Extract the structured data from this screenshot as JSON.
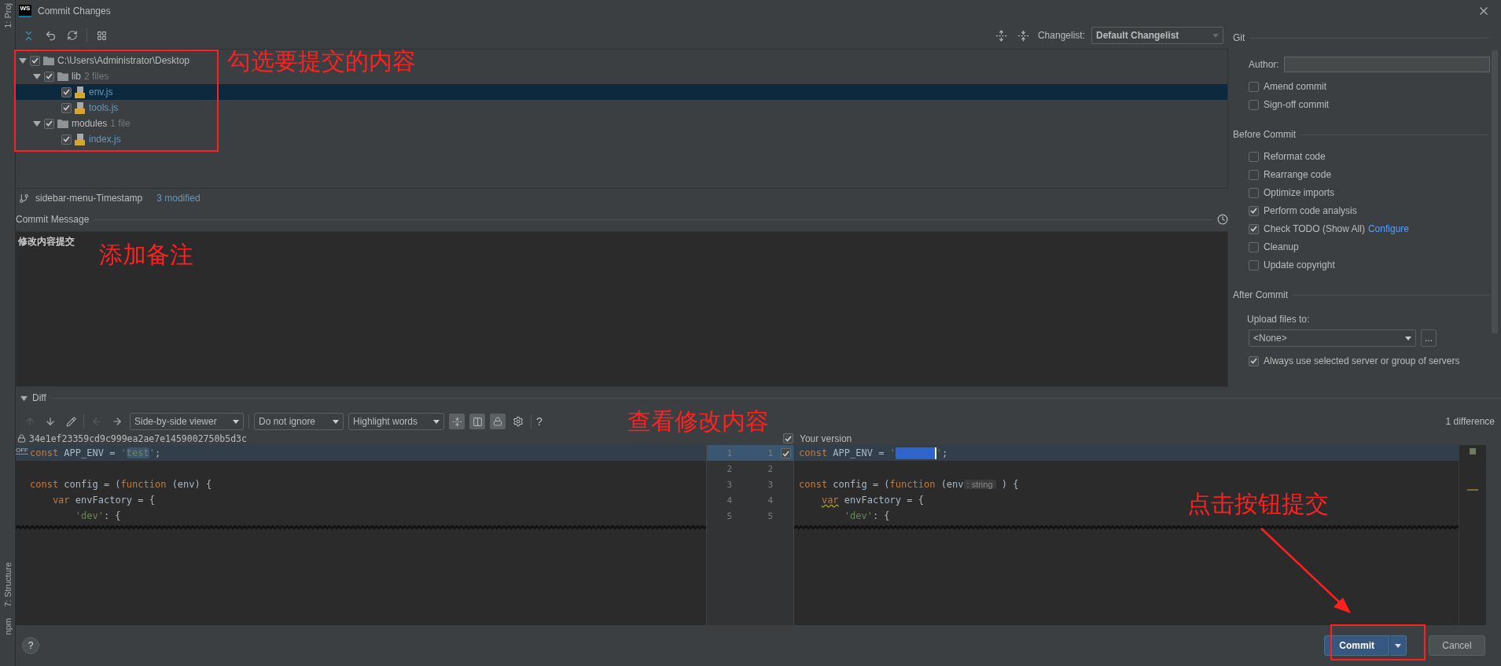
{
  "window": {
    "logo": "WS",
    "title": "Commit Changes"
  },
  "side_strip": [
    "1: Proj",
    "7: Structure",
    "npm"
  ],
  "toolbar": {
    "changelist_label": "Changelist:",
    "changelist": "Default Changelist"
  },
  "tree": [
    {
      "kind": "folder",
      "label": "C:\\Users\\Administrator\\Desktop",
      "checked": true,
      "expanded": true,
      "selected": false,
      "children": [
        {
          "kind": "folder",
          "label": "lib",
          "count": "2 files",
          "checked": true,
          "expanded": true,
          "selected": false,
          "children": [
            {
              "kind": "file",
              "label": "env.js",
              "checked": true,
              "selected": true
            },
            {
              "kind": "file",
              "label": "tools.js",
              "checked": true,
              "selected": false
            }
          ]
        },
        {
          "kind": "folder",
          "label": "modules",
          "count": "1 file",
          "checked": true,
          "expanded": true,
          "selected": false,
          "children": [
            {
              "kind": "file",
              "label": "index.js",
              "checked": true,
              "selected": false
            }
          ]
        }
      ]
    }
  ],
  "branch": {
    "name": "sidebar-menu-Timestamp",
    "status": "3 modified"
  },
  "commit_message": {
    "label": "Commit Message",
    "value": "修改内容提交"
  },
  "git": {
    "title": "Git",
    "author_label": "Author:",
    "options": [
      {
        "label": "Amend commit",
        "checked": false
      },
      {
        "label": "Sign-off commit",
        "checked": false
      }
    ]
  },
  "before_commit": {
    "title": "Before Commit",
    "options": [
      {
        "label": "Reformat code",
        "checked": false
      },
      {
        "label": "Rearrange code",
        "checked": false
      },
      {
        "label": "Optimize imports",
        "checked": false
      },
      {
        "label": "Perform code analysis",
        "checked": true
      },
      {
        "label": "Check TODO (Show All)",
        "link": "Configure",
        "checked": true
      },
      {
        "label": "Cleanup",
        "checked": false
      },
      {
        "label": "Update copyright",
        "checked": false
      }
    ]
  },
  "after_commit": {
    "title": "After Commit",
    "upload_label": "Upload files to:",
    "upload_value": "<None>",
    "more": "...",
    "always": {
      "label": "Always use selected server or group of servers",
      "checked": true
    }
  },
  "diff": {
    "title": "Diff",
    "expanded": true,
    "viewer": "Side-by-side viewer",
    "ignore": "Do not ignore",
    "highlight": "Highlight words",
    "help": "?",
    "count": "1 difference",
    "hash": "34e1ef23359cd9c999ea2ae7e1459002750b5d3c",
    "left_marker": "OFF",
    "your_version": {
      "label": "Your version",
      "checked": true
    },
    "rows": [
      {
        "left_num": "1",
        "right_num": "1",
        "changed": true,
        "included": true,
        "left": [
          {
            "keyword": "const"
          },
          {
            "text": " APP_ENV = "
          },
          {
            "string": "'"
          },
          {
            "changed": "test"
          },
          {
            "string": "'"
          },
          {
            "text": ";"
          }
        ],
        "right": [
          {
            "keyword": "const"
          },
          {
            "text": " APP_ENV = "
          },
          {
            "string": "'"
          },
          {
            "masked": true
          },
          {
            "string": "'"
          },
          {
            "text": ";"
          }
        ]
      },
      {
        "left_num": "2",
        "right_num": "2",
        "changed": false
      },
      {
        "left_num": "3",
        "right_num": "3",
        "changed": false,
        "left": [
          {
            "keyword": "const"
          },
          {
            "text": " config = ("
          },
          {
            "keyword": "function"
          },
          {
            "text": " (env) {"
          }
        ],
        "right": [
          {
            "keyword": "const"
          },
          {
            "text": " config = ("
          },
          {
            "keyword": "function"
          },
          {
            "text": " (env"
          },
          {
            "hint": ": string"
          },
          {
            "text": " ) {"
          }
        ]
      },
      {
        "left_num": "4",
        "right_num": "4",
        "changed": false,
        "left": [
          {
            "keyword": "    var"
          },
          {
            "text": " envFactory = {"
          }
        ],
        "right": [
          {
            "warning": "    var"
          },
          {
            "text": " envFactory = {"
          }
        ]
      },
      {
        "left_num": "5",
        "right_num": "5",
        "changed": false,
        "left": [
          {
            "string": "        'dev'"
          },
          {
            "text": ": {"
          }
        ],
        "right": [
          {
            "string": "        'dev'"
          },
          {
            "text": ": {"
          }
        ]
      }
    ]
  },
  "buttons": {
    "help": "?",
    "commit": "Commit",
    "cancel": "Cancel"
  },
  "annotations": [
    {
      "text": "勾选要提交的内容"
    },
    {
      "text": "添加备注"
    },
    {
      "text": "查看修改内容"
    },
    {
      "text": "点击按钮提交"
    }
  ]
}
